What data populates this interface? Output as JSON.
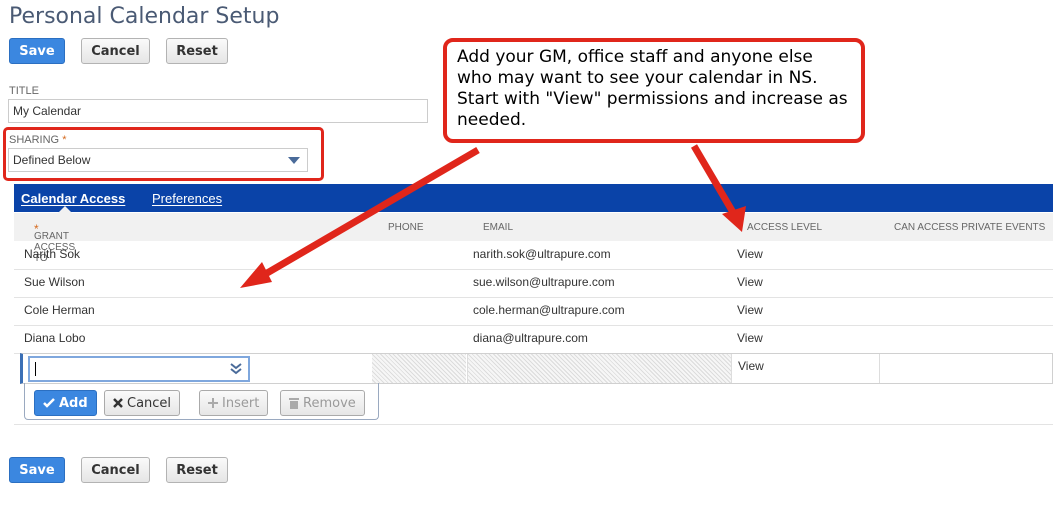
{
  "page": {
    "title": "Personal Calendar Setup"
  },
  "toolbar": {
    "save": "Save",
    "cancel": "Cancel",
    "reset": "Reset"
  },
  "form": {
    "title_label": "TITLE",
    "title_value": "My Calendar",
    "sharing_label": "SHARING",
    "required_mark": "*",
    "sharing_value": "Defined Below"
  },
  "tabs": [
    "Calendar Access",
    "Preferences"
  ],
  "table": {
    "columns": [
      "GRANT ACCESS TO",
      "PHONE",
      "EMAIL",
      "ACCESS LEVEL",
      "CAN ACCESS PRIVATE EVENTS"
    ],
    "rows": [
      {
        "name": "Narith Sok",
        "email": "narith.sok@ultrapure.com",
        "level": "View"
      },
      {
        "name": "Sue Wilson",
        "email": "sue.wilson@ultrapure.com",
        "level": "View"
      },
      {
        "name": "Cole Herman",
        "email": "cole.herman@ultrapure.com",
        "level": "View"
      },
      {
        "name": "Diana Lobo",
        "email": "diana@ultrapure.com",
        "level": "View"
      }
    ],
    "new_row_level": "View"
  },
  "row_actions": {
    "add": "Add",
    "cancel": "Cancel",
    "insert": "Insert",
    "remove": "Remove"
  },
  "callout": {
    "text": "Add your GM, office staff and anyone else who may want to see your calendar in NS. Start with \"View\" permissions and increase as needed."
  },
  "colors": {
    "accent": "#0a43a8",
    "primary_button": "#3b87e0",
    "annotation": "#e0261b"
  }
}
